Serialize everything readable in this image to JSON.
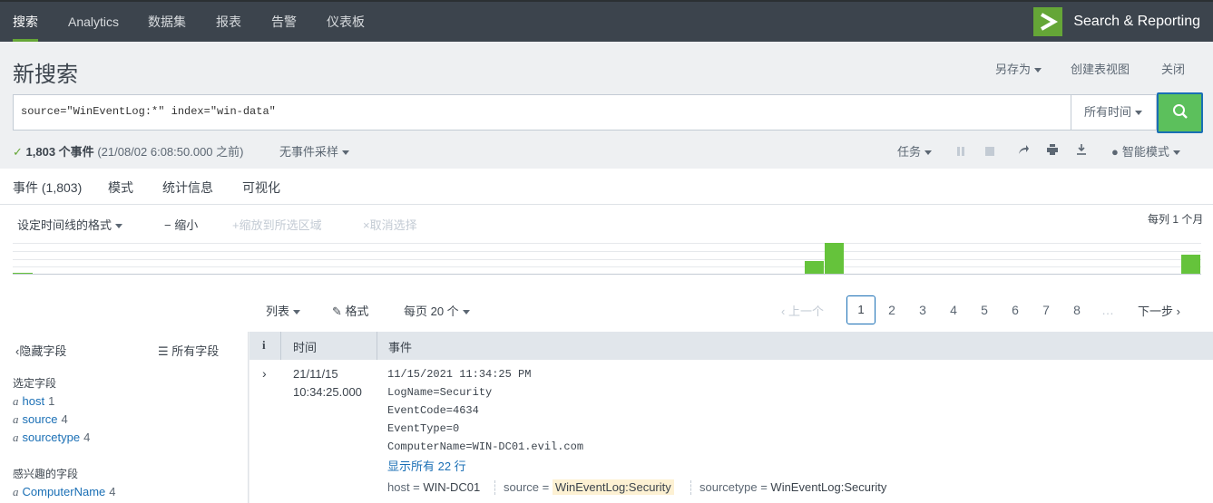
{
  "nav": {
    "tabs": [
      "搜索",
      "Analytics",
      "数据集",
      "报表",
      "告警",
      "仪表板"
    ],
    "app_title": "Search & Reporting"
  },
  "header": {
    "title": "新搜索",
    "save_as": "另存为",
    "create_table_view": "创建表视图",
    "close": "关闭"
  },
  "search": {
    "query": "source=\"WinEventLog:*\" index=\"win-data\"",
    "time_range": "所有时间"
  },
  "status": {
    "count": "1,803 个事件",
    "detail": "(21/08/02 6:08:50.000 之前)",
    "sampling": "无事件采样",
    "job": "任务",
    "mode": "智能模式"
  },
  "tabs": [
    "事件 (1,803)",
    "模式",
    "统计信息",
    "可视化"
  ],
  "timeline": {
    "format": "设定时间线的格式",
    "zoom_out": "缩小",
    "zoom_selection": "缩放到所选区域",
    "deselect": "取消选择",
    "scale": "每列 1 个月",
    "bars": [
      {
        "label": "bar-1",
        "value": 0.04
      },
      {
        "label": "bar-2",
        "value": 0.42
      },
      {
        "label": "bar-3",
        "value": 1.0
      },
      {
        "label": "bar-4",
        "value": 0.62
      }
    ]
  },
  "results_controls": {
    "list": "列表",
    "format": "格式",
    "per_page": "每页 20 个",
    "prev": "上一个",
    "next": "下一步",
    "pages": [
      "1",
      "2",
      "3",
      "4",
      "5",
      "6",
      "7",
      "8"
    ],
    "ellipsis": "…",
    "current_page": "1"
  },
  "sidebar": {
    "hide_fields": "隐藏字段",
    "all_fields": "所有字段",
    "selected_heading": "选定字段",
    "selected": [
      {
        "name": "host",
        "count": "1"
      },
      {
        "name": "source",
        "count": "4"
      },
      {
        "name": "sourcetype",
        "count": "4"
      }
    ],
    "interesting_heading": "感兴趣的字段",
    "interesting": [
      {
        "name": "ComputerName",
        "count": "4"
      }
    ],
    "type_glyph": "a"
  },
  "table": {
    "col_info": "i",
    "col_time": "时间",
    "col_event": "事件",
    "rows": [
      {
        "date": "21/11/15",
        "time": "10:34:25.000",
        "lines": [
          "11/15/2021 11:34:25 PM",
          "LogName=Security",
          "EventCode=4634",
          "EventType=0",
          "ComputerName=WIN-DC01.evil.com"
        ],
        "show_all": "显示所有 22 行",
        "fields": [
          {
            "key": "host =",
            "value": "WIN-DC01"
          },
          {
            "key": "source =",
            "value": "WinEventLog:Security"
          },
          {
            "key": "sourcetype =",
            "value": "WinEventLog:Security"
          }
        ]
      }
    ]
  },
  "colors": {
    "accent_green": "#65a637",
    "link_blue": "#1a6fb5",
    "search_button": "#5cc05c"
  }
}
